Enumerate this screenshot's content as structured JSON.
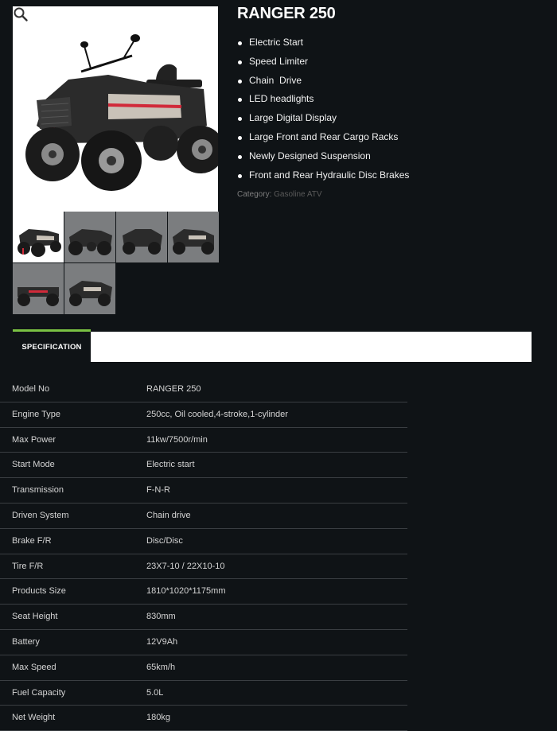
{
  "product": {
    "title": "RANGER 250",
    "features": [
      "Electric Start",
      "Speed Limiter",
      "Chain  Drive",
      "LED headlights",
      "Large Digital Display",
      "Large Front and Rear Cargo Racks",
      "Newly Designed Suspension",
      "Front and Rear Hydraulic Disc Brakes"
    ],
    "category_label": "Category:",
    "category_link": "Gasoline ATV"
  },
  "gallery": {
    "zoom_icon": "magnifier-icon",
    "thumbnail_count": 6
  },
  "tabs": {
    "active_label": "SPECIFICATION"
  },
  "specs": [
    {
      "key": "Model No",
      "value": "RANGER 250"
    },
    {
      "key": "Engine Type",
      "value": "250cc, Oil cooled,4-stroke,1-cylinder"
    },
    {
      "key": "Max Power",
      "value": "11kw/7500r/min"
    },
    {
      "key": "Start Mode",
      "value": "Electric start"
    },
    {
      "key": "Transmission",
      "value": "F-N-R"
    },
    {
      "key": "Driven System",
      "value": "Chain drive"
    },
    {
      "key": "Brake F/R",
      "value": "Disc/Disc"
    },
    {
      "key": "Tire F/R",
      "value": "23X7-10 / 22X10-10"
    },
    {
      "key": "Products Size",
      "value": "1810*1020*1175mm"
    },
    {
      "key": "Seat Height",
      "value": "830mm"
    },
    {
      "key": "Battery",
      "value": "12V9Ah"
    },
    {
      "key": "Max Speed",
      "value": "65km/h"
    },
    {
      "key": "Fuel Capacity",
      "value": "5.0L"
    },
    {
      "key": "Net Weight",
      "value": "180kg"
    }
  ],
  "colors": {
    "background": "#0f1316",
    "accent": "#7ac143",
    "atv_body": "#2b2b2b",
    "atv_trim": "#d12a3a"
  }
}
